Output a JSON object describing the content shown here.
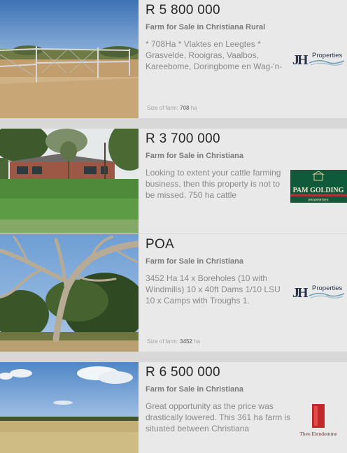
{
  "listings": [
    {
      "price": "R 5 800 000",
      "type": "Farm for Sale in Christiana Rural",
      "description": "* 708Ha * Vlaktes en Leegtes * Grasvelde, Rooigras, Vaalbos, Kareebome, Doringbome en Wag-'n-",
      "size_label": "Size of farm:",
      "size_value": "708",
      "size_unit": "ha",
      "agency_logo": "jh-properties-logo",
      "agency_text_j": "J",
      "agency_text_h": "H",
      "agency_text": "Properties"
    },
    {
      "price": "R 3 700 000",
      "type": "Farm for Sale in Christiana",
      "description": "Looking to extent your cattle farming business, then this property is not to be missed. 750 ha cattle",
      "agency_logo": "pam-golding-logo",
      "agency_text": "PAM GOLDING",
      "agency_subtext": "PROPERTIES"
    },
    {
      "price": "POA",
      "type": "Farm for Sale in Christiana",
      "description": "3452 Ha 14 x Boreholes (10 with Windmills) 10 x 40ft Dams 1/10 LSU 10 x Camps with Troughs 1.",
      "size_label": "Size of farm:",
      "size_value": "3452",
      "size_unit": "ha",
      "agency_logo": "jh-properties-logo",
      "agency_text_j": "J",
      "agency_text_h": "H",
      "agency_text": "Properties"
    },
    {
      "price": "R 6 500 000",
      "type": "Farm for Sale in Christiana",
      "description": "Great opportunity as the price was drastically lowered. This 361 ha farm is situated between Christiana",
      "agency_logo": "theo-eiendomme-logo",
      "agency_text": "Theo Eiendomme"
    }
  ]
}
